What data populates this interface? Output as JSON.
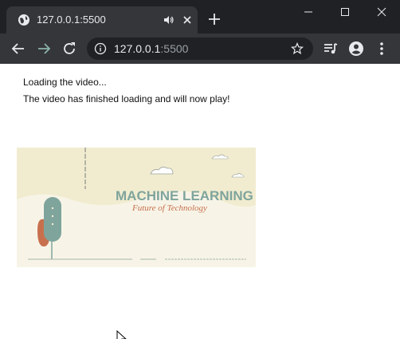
{
  "browser": {
    "tab": {
      "title": "127.0.0.1:5500",
      "favicon": "globe-icon",
      "audio_indicator": "speaker-icon",
      "close": "close-icon"
    },
    "new_tab": "plus-icon",
    "window_controls": [
      "minimize-icon",
      "maximize-icon",
      "close-icon"
    ],
    "toolbar": {
      "back": "arrow-left-icon",
      "forward": "arrow-right-icon",
      "reload": "reload-icon",
      "url_host": "127.0.0.1",
      "url_port": ":5500",
      "site_info": "info-icon",
      "bookmark": "star-icon",
      "media_control": "media-queue-icon",
      "profile": "profile-icon",
      "menu": "kebab-menu-icon"
    }
  },
  "page": {
    "messages": [
      "Loading the video...",
      "The video has finished loading and will now play!"
    ],
    "video": {
      "title": "MACHINE LEARNING",
      "subtitle": "Future of Technology"
    }
  },
  "colors": {
    "chrome_dark": "#202124",
    "chrome_toolbar": "#35363a",
    "video_bg": "#f1ecd0",
    "video_title": "#7fa49c",
    "video_subtitle": "#c8704e"
  }
}
